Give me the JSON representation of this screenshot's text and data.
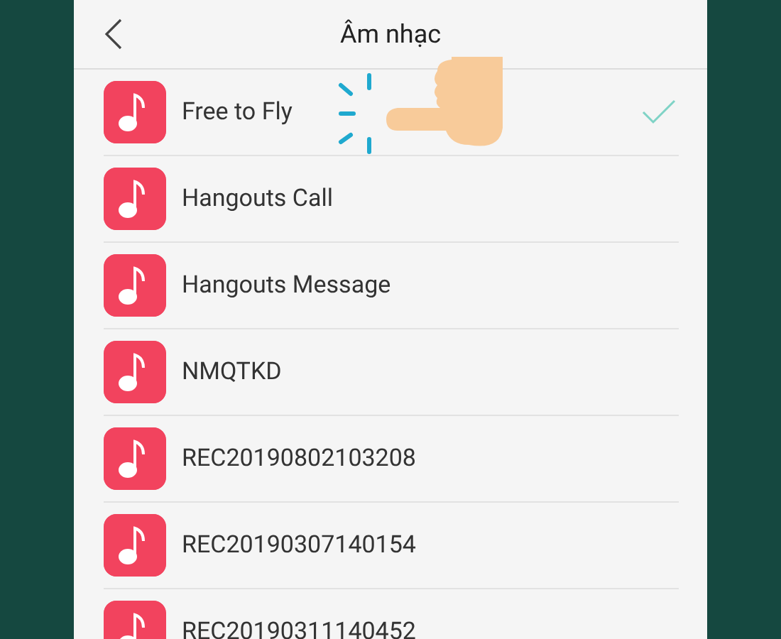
{
  "header": {
    "title": "Âm nhạc"
  },
  "items": [
    {
      "label": "Free to Fly",
      "selected": true
    },
    {
      "label": "Hangouts Call",
      "selected": false
    },
    {
      "label": "Hangouts Message",
      "selected": false
    },
    {
      "label": "NMQTKD",
      "selected": false
    },
    {
      "label": "REC20190802103208",
      "selected": false
    },
    {
      "label": "REC20190307140154",
      "selected": false
    },
    {
      "label": "REC20190311140452",
      "selected": false
    }
  ]
}
